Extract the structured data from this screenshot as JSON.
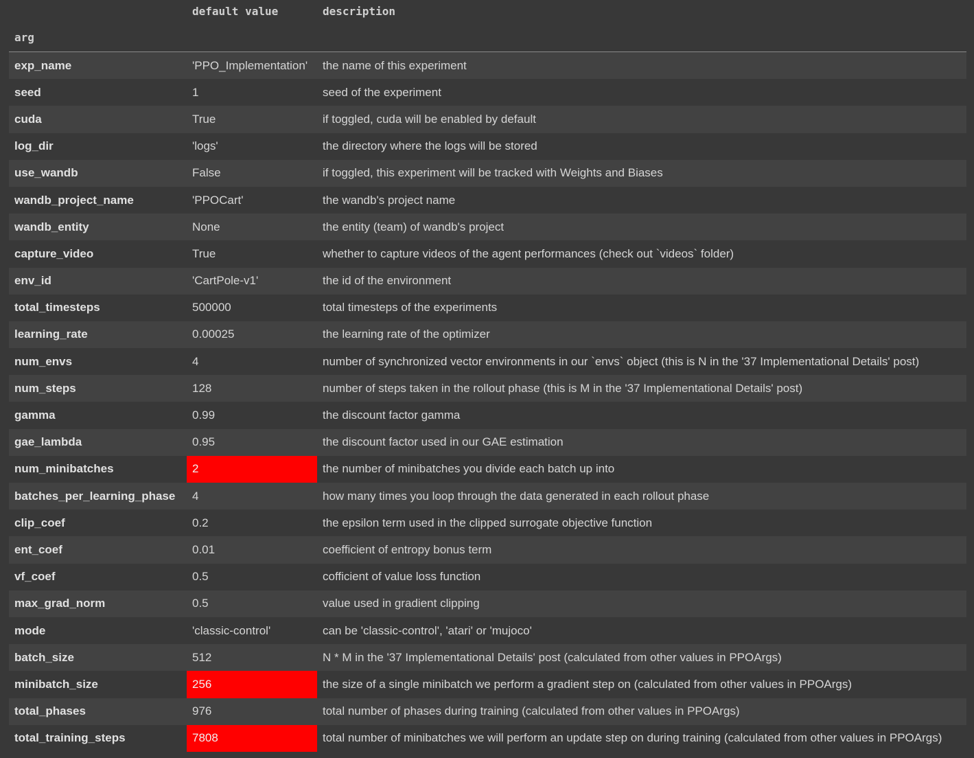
{
  "headers": {
    "default_value": "default value",
    "description": "description",
    "index_name": "arg"
  },
  "highlight_color": "#ff0000",
  "rows": [
    {
      "arg": "exp_name",
      "default": "'PPO_Implementation'",
      "description": "the name of this experiment",
      "highlight": false
    },
    {
      "arg": "seed",
      "default": "1",
      "description": "seed of the experiment",
      "highlight": false
    },
    {
      "arg": "cuda",
      "default": "True",
      "description": "if toggled, cuda will be enabled by default",
      "highlight": false
    },
    {
      "arg": "log_dir",
      "default": "'logs'",
      "description": "the directory where the logs will be stored",
      "highlight": false
    },
    {
      "arg": "use_wandb",
      "default": "False",
      "description": "if toggled, this experiment will be tracked with Weights and Biases",
      "highlight": false
    },
    {
      "arg": "wandb_project_name",
      "default": "'PPOCart'",
      "description": "the wandb's project name",
      "highlight": false
    },
    {
      "arg": "wandb_entity",
      "default": "None",
      "description": "the entity (team) of wandb's project",
      "highlight": false
    },
    {
      "arg": "capture_video",
      "default": "True",
      "description": "whether to capture videos of the agent performances (check out `videos` folder)",
      "highlight": false
    },
    {
      "arg": "env_id",
      "default": "'CartPole-v1'",
      "description": "the id of the environment",
      "highlight": false
    },
    {
      "arg": "total_timesteps",
      "default": "500000",
      "description": "total timesteps of the experiments",
      "highlight": false
    },
    {
      "arg": "learning_rate",
      "default": "0.00025",
      "description": "the learning rate of the optimizer",
      "highlight": false
    },
    {
      "arg": "num_envs",
      "default": "4",
      "description": "number of synchronized vector environments in our `envs` object (this is N in the '37 Implementational Details' post)",
      "highlight": false
    },
    {
      "arg": "num_steps",
      "default": "128",
      "description": "number of steps taken in the rollout phase (this is M in the '37 Implementational Details' post)",
      "highlight": false
    },
    {
      "arg": "gamma",
      "default": "0.99",
      "description": "the discount factor gamma",
      "highlight": false
    },
    {
      "arg": "gae_lambda",
      "default": "0.95",
      "description": "the discount factor used in our GAE estimation",
      "highlight": false
    },
    {
      "arg": "num_minibatches",
      "default": "2",
      "description": "the number of minibatches you divide each batch up into",
      "highlight": true
    },
    {
      "arg": "batches_per_learning_phase",
      "default": "4",
      "description": "how many times you loop through the data generated in each rollout phase",
      "highlight": false
    },
    {
      "arg": "clip_coef",
      "default": "0.2",
      "description": "the epsilon term used in the clipped surrogate objective function",
      "highlight": false
    },
    {
      "arg": "ent_coef",
      "default": "0.01",
      "description": "coefficient of entropy bonus term",
      "highlight": false
    },
    {
      "arg": "vf_coef",
      "default": "0.5",
      "description": "cofficient of value loss function",
      "highlight": false
    },
    {
      "arg": "max_grad_norm",
      "default": "0.5",
      "description": "value used in gradient clipping",
      "highlight": false
    },
    {
      "arg": "mode",
      "default": "'classic-control'",
      "description": "can be 'classic-control', 'atari' or 'mujoco'",
      "highlight": false
    },
    {
      "arg": "batch_size",
      "default": "512",
      "description": "N * M in the '37 Implementational Details' post (calculated from other values in PPOArgs)",
      "highlight": false
    },
    {
      "arg": "minibatch_size",
      "default": "256",
      "description": "the size of a single minibatch we perform a gradient step on (calculated from other values in PPOArgs)",
      "highlight": true
    },
    {
      "arg": "total_phases",
      "default": "976",
      "description": "total number of phases during training (calculated from other values in PPOArgs)",
      "highlight": false
    },
    {
      "arg": "total_training_steps",
      "default": "7808",
      "description": "total number of minibatches we will perform an update step on during training (calculated from other values in PPOArgs)",
      "highlight": true
    }
  ]
}
